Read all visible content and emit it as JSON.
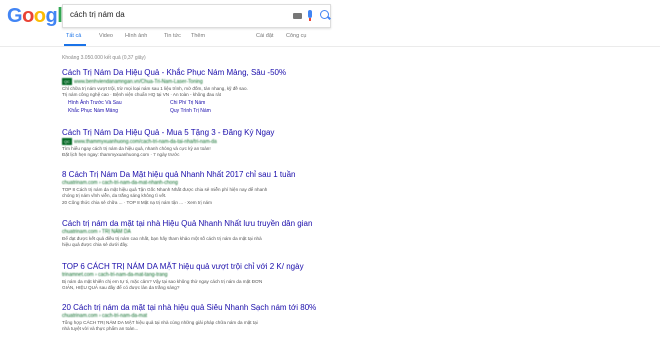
{
  "logo": {
    "letters": [
      "G",
      "o",
      "o",
      "g",
      "l",
      "e"
    ]
  },
  "search": {
    "query": "cách trị nám da"
  },
  "tabs": {
    "all": "Tất cả",
    "video": "Video",
    "images": "Hình ảnh",
    "news": "Tin tức",
    "more": "Thêm",
    "settings": "Cài đặt",
    "tools": "Công cụ"
  },
  "stats": "Khoảng 3.050.000 kết quả (0,37 giây)",
  "results": [
    {
      "title": "Cách Trị Nám Da Hiệu Quả - Khắc Phục Nám Mảng, Sâu -50%",
      "ad": "QC",
      "url": "www.benhviendanamngan.vn/Chua-Tri-Nam-Laser-Toning",
      "snippet1": "Chỉ chữa trị nám vượt trội, trừ mọi loại nám sau 1 liệu trình, mờ đốm, tàn nhang, kỹ đề sao.",
      "snippet2": "Trị nám công nghệ cao · Bệnh viện chuẩn HQ tại VN · An toàn - không đau rát",
      "sitelinks": [
        "Hình Ảnh Trước Và Sau",
        "Chi Phí Trị Nám",
        "Khắc Phục Nám Mảng",
        "Quy Trình Trị Nám"
      ]
    },
    {
      "title": "Cách Trị Nám Da Hiệu Quả - Mua 5 Tặng 3 - Đăng Ký Ngay",
      "ad": "QC",
      "url": "www.thammyxuanhuong.com/cach-tri-nam-da-tai-nha/tri-nam-da",
      "snippet1": "Tìm hiểu ngay cách trị nám da hiệu quả, nhanh chóng và cực kỳ an toàn!",
      "snippet2": "Đặt lịch hẹn ngay: thammyxuanhuong.com · 7 ngày trước"
    },
    {
      "title": "8 Cách Trị Nám Da Mặt hiệu quả Nhanh Nhất 2017 chỉ sau 1 tuần",
      "url": "chuatrinam.com › cach-tri-nam-da-mat-nhanh-chong",
      "snippet1": "TOP 8 Cách trị nám da mặt hiệu quả Tận Gốc Nhanh Nhất được chia sẻ miễn phí hiện nay để nhanh",
      "snippet2": "chóng trị nám vĩnh viễn, da trắng sáng không tì vết.",
      "snippet3": "20 Công thức chia sẻ chữa ... · TOP 8 Mặt nạ trị nám tận ... · Xem trị nám"
    },
    {
      "title": "Cách trị nám da mặt tại nhà Hiệu Quả Nhanh Nhất lưu truyền dân gian",
      "url": "chuatrinam.com › TRỊ NÁM DA",
      "snippet1": "Để đạt được kết quả điều trị nám cao nhất, bạn hãy tham khảo một số cách trị nám da mặt tại nhà",
      "snippet2": "hiệu quả được chia sẻ dưới đây."
    },
    {
      "title": "TOP 6 CÁCH TRỊ NÁM DA MẶT hiệu quả vượt trội chỉ với 2 K/ ngày",
      "url": "trinamnet.com › cach-tri-nam-da-mat-tang-trang",
      "snippet1": "Bị nám da mặt khiến chị em tự ti, mặc cảm? Vậy tại sao không thử ngay cách trị nám da mặt ĐƠN",
      "snippet2": "GIẢN, HIỆU QUẢ sau đây để có được làn da trắng sáng?"
    },
    {
      "title": "20 Cách trị nám da mặt tại nhà hiệu quả Siêu Nhanh Sạch nám tới 80%",
      "url": "chuatrinam.com › cach-tri-nam-da-mat",
      "snippet1": "Tổng hợp CÁCH TRỊ NÁM DA MẶT hiệu quả tại nhà cùng những giải pháp chữa nám da mặt tại",
      "snippet2": "nhà tuyệt vời và thực phẩm an toàn..."
    }
  ]
}
